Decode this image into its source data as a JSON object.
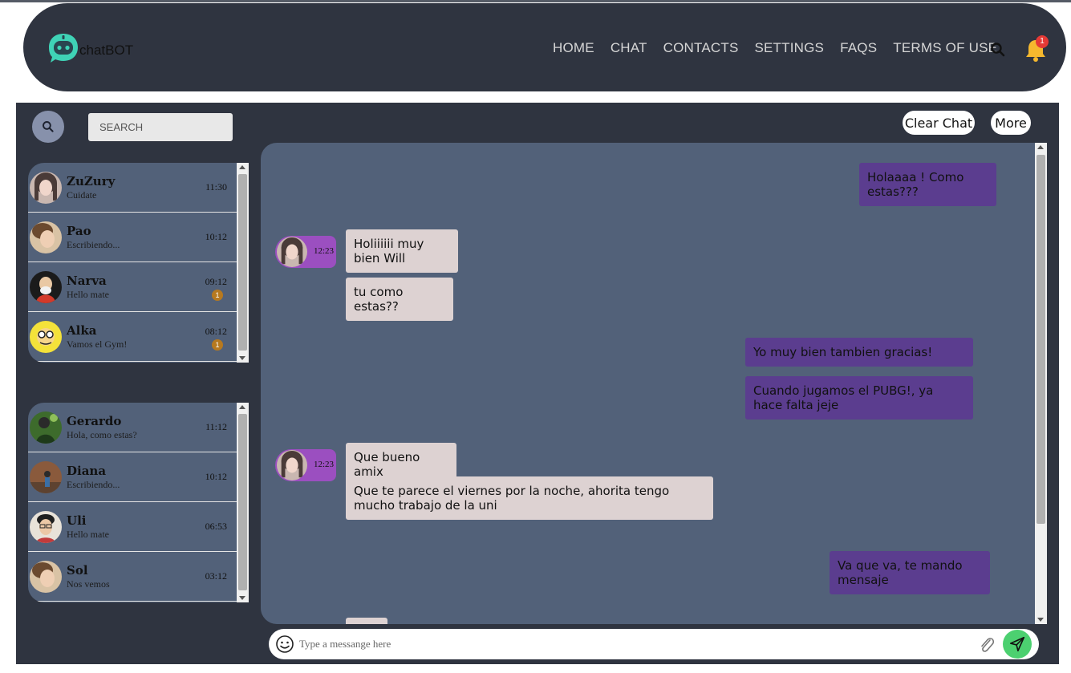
{
  "brand": {
    "name": "chatBOT",
    "logo_icon": "robot-chat-icon",
    "accent": "#3fd3b6"
  },
  "nav": {
    "links": [
      "HOME",
      "CHAT",
      "CONTACTS",
      "SETTINGS",
      "FAQS",
      "TERMS OF USE"
    ],
    "notification_count": "1"
  },
  "sidebar": {
    "search_placeholder": "SEARCH",
    "lists": [
      {
        "contacts": [
          {
            "name": "ZuZury",
            "status": "Cuidate",
            "time": "11:30",
            "badge": ""
          },
          {
            "name": "Pao",
            "status": "Escribiendo...",
            "time": "10:12",
            "badge": ""
          },
          {
            "name": "Narva",
            "status": "Hello mate",
            "time": "09:12",
            "badge": "1"
          },
          {
            "name": "Alka",
            "status": "Vamos el Gym!",
            "time": "08:12",
            "badge": "1"
          }
        ]
      },
      {
        "contacts": [
          {
            "name": "Gerardo",
            "status": "Hola, como estas?",
            "time": "11:12",
            "badge": ""
          },
          {
            "name": "Diana",
            "status": "Escribiendo...",
            "time": "10:12",
            "badge": ""
          },
          {
            "name": "Uli",
            "status": "Hello mate",
            "time": "06:53",
            "badge": ""
          },
          {
            "name": "Sol",
            "status": "Nos vemos",
            "time": "03:12",
            "badge": ""
          }
        ]
      }
    ]
  },
  "chat": {
    "actions": {
      "clear": "Clear Chat",
      "more": "More"
    },
    "messages": [
      {
        "from": "me",
        "text": "Holaaaa ! Como estas???"
      },
      {
        "from": "them",
        "text": "Holiiiiii muy bien Will"
      },
      {
        "from": "them",
        "text": "tu como estas??"
      },
      {
        "from": "me",
        "text": "Yo muy bien tambien gracias!"
      },
      {
        "from": "me",
        "text": "Cuando jugamos el PUBG!, ya hace falta jeje"
      },
      {
        "from": "them",
        "text": "Que bueno amix"
      },
      {
        "from": "them",
        "text": "Que te parece el viernes por la noche, ahorita tengo mucho trabajo de la uni"
      },
      {
        "from": "me",
        "text": "Va que va, te mando mensaje"
      }
    ],
    "sender_times": [
      "12:23",
      "12:23"
    ],
    "composer": {
      "placeholder": "Type a messange here"
    },
    "colors": {
      "outgoing": "#5b3d8f",
      "incoming": "#ddd2d2",
      "send": "#4cd070"
    }
  }
}
